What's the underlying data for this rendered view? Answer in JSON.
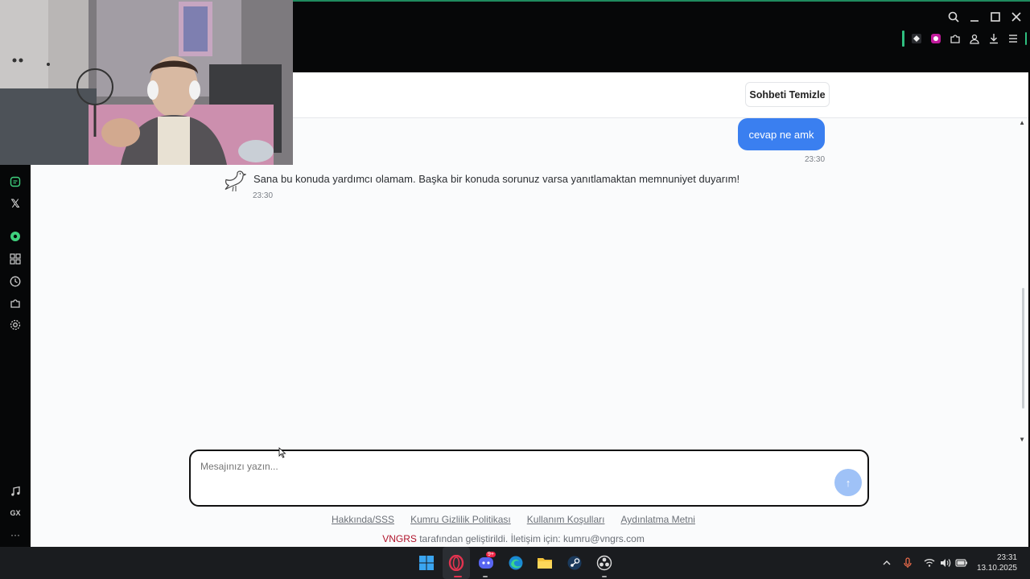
{
  "chat": {
    "clear_button_label": "Sohbeti Temizle",
    "messages": [
      {
        "role": "user",
        "text": "cevap ne amk",
        "time": "23:30"
      },
      {
        "role": "assistant",
        "text": "Sana bu konuda yardımcı olamam. Başka bir konuda sorunuz varsa yanıtlamaktan memnuniyet duyarım!",
        "time": "23:30"
      }
    ],
    "input_placeholder": "Mesajınızı yazın...",
    "send_icon": "arrow-up-icon"
  },
  "footer": {
    "links": [
      "Hakkında/SSS",
      "Kumru Gizlilik Politikası",
      "Kullanım Koşulları",
      "Aydınlatma Metni"
    ],
    "brand": "VNGRS",
    "note_rest": " tarafından geliştirildi. İletişim için: kumru@vngrs.com"
  },
  "sidebar": {
    "icons": [
      "whatsapp-icon",
      "x-twitter-icon",
      "player-icon",
      "apps-icon",
      "history-icon",
      "extensions-icon",
      "settings-icon",
      "music-icon",
      "gx-icon",
      "more-icon"
    ],
    "gx_label": "GX",
    "x_label": "𝕏",
    "more_label": "···"
  },
  "browser": {
    "window_icons": [
      "search-icon",
      "minimize-icon",
      "maximize-icon",
      "close-icon"
    ],
    "extension_icons": [
      "extension-1-icon",
      "extension-2-icon",
      "puzzle-icon",
      "profile-icon",
      "download-icon",
      "menu-icon"
    ]
  },
  "taskbar": {
    "apps": [
      "windows-start-icon",
      "opera-gx-icon",
      "discord-icon",
      "edge-icon",
      "file-explorer-icon",
      "steam-icon",
      "obs-icon"
    ],
    "discord_badge": "9+",
    "tray": [
      "chevron-up-icon",
      "microphone-icon",
      "wifi-icon",
      "volume-icon",
      "battery-icon"
    ],
    "time": "23:31",
    "date": "13.10.2025"
  },
  "colors": {
    "accent_blue": "#3a7ff0",
    "brand_red": "#b0132b",
    "gx_green": "#2fbf80"
  }
}
